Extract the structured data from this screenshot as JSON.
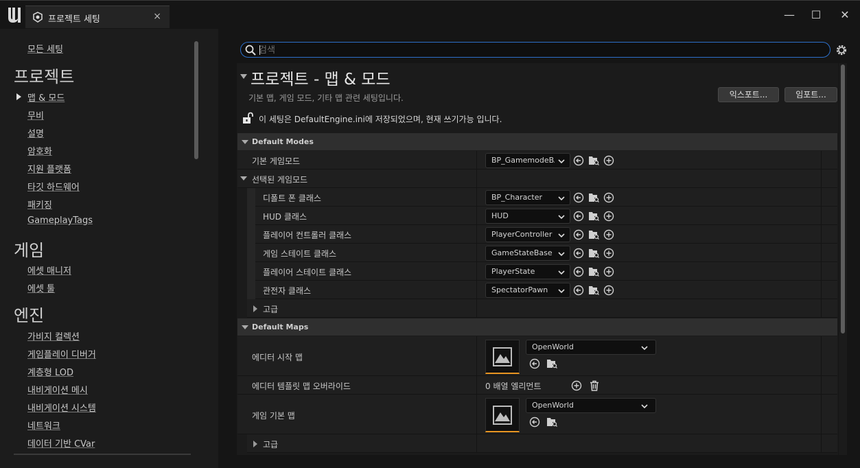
{
  "window": {
    "tab_title": "프로젝트 세팅",
    "tab_close": "×",
    "minimize": "—",
    "maximize": "☐",
    "close": "✕"
  },
  "sidebar": {
    "all_settings": "모든 세팅",
    "categories": [
      {
        "title": "프로젝트",
        "items": [
          "맵 & 모드",
          "무비",
          "설명",
          "암호화",
          "지원 플랫폼",
          "타깃 하드웨어",
          "패키징",
          "GameplayTags"
        ]
      },
      {
        "title": "게임",
        "items": [
          "에셋 매니저",
          "에셋 툴"
        ]
      },
      {
        "title": "엔진",
        "items": [
          "가비지 컬렉션",
          "게임플레이 디버거",
          "계층형 LOD",
          "내비게이션 메시",
          "내비게이션 시스템",
          "네트워크",
          "데이터 기반 CVar"
        ]
      }
    ],
    "selected_item": "맵 & 모드"
  },
  "search": {
    "placeholder": "검색",
    "value": ""
  },
  "header": {
    "title": "프로젝트 - 맵 & 모드",
    "description": "기본 맵, 게임 모드, 기타 맵 관련 세팅입니다.",
    "export_button": "익스포트...",
    "import_button": "임포트...",
    "config_notice": "이 세팅은 DefaultEngine.ini에 저장되었으며, 현재 쓰기가능 입니다."
  },
  "default_modes": {
    "section_label": "Default Modes",
    "default_gamemode": {
      "label": "기본 게임모드",
      "value": "BP_GamemodeBA"
    },
    "selected_gamemode": {
      "label": "선택된 게임모드",
      "rows": [
        {
          "label": "디폴트 폰 클래스",
          "value": "BP_Character"
        },
        {
          "label": "HUD 클래스",
          "value": "HUD"
        },
        {
          "label": "플레이어 컨트롤러 클래스",
          "value": "PlayerController"
        },
        {
          "label": "게임 스테이트 클래스",
          "value": "GameStateBase"
        },
        {
          "label": "플레이어 스테이트 클래스",
          "value": "PlayerState"
        },
        {
          "label": "관전자 클래스",
          "value": "SpectatorPawn"
        }
      ]
    },
    "advanced_label": "고급"
  },
  "default_maps": {
    "section_label": "Default Maps",
    "editor_startup_map": {
      "label": "에디터 시작 맵",
      "value": "OpenWorld"
    },
    "editor_template_override": {
      "label": "에디터 템플릿 맵 오버라이드",
      "value": "0 배열 엘리먼트"
    },
    "game_default_map": {
      "label": "게임 기본 맵",
      "value": "OpenWorld"
    },
    "advanced_label": "고급"
  },
  "colors": {
    "accent": "#2c6fc9",
    "thumb_underline": "#e89522"
  }
}
